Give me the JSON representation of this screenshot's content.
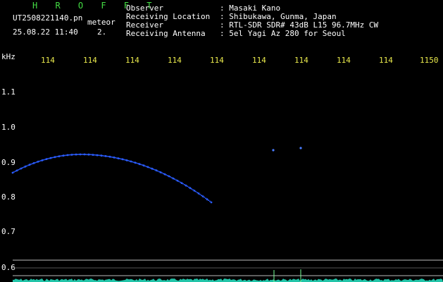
{
  "header": {
    "logo_text": "H R O F F T",
    "filename": "UT2508221140.pn",
    "tag": "meteor",
    "datetime": "25.08.22 11:40",
    "index": "2.",
    "info": [
      {
        "label": "Observer",
        "value": ": Masaki Kano"
      },
      {
        "label": "Receiving Location",
        "value": ": Shibukawa, Gunma, Japan"
      },
      {
        "label": "Receiver",
        "value": ": RTL-SDR SDR# 43dB L15 96.7MHz CW"
      },
      {
        "label": "Receiving Antenna",
        "value": ": 5el Yagi Az 280 for Seoul"
      }
    ]
  },
  "axis": {
    "unit_label": "kHz",
    "x_ticks": [
      "114",
      "114",
      "114",
      "114",
      "114",
      "114",
      "114",
      "114",
      "114",
      "1150"
    ],
    "y_ticks": [
      "1.1",
      "1.0",
      "0.9",
      "0.8",
      "0.7",
      "0.6"
    ]
  },
  "colors": {
    "background": "#000000",
    "text": "#ffffff",
    "logo": "#44dd44",
    "x_ticks": "#e9e94c",
    "trace": "#2a5cff",
    "spectrum": "#22c4a8",
    "grid": "#bbbbbb"
  }
}
